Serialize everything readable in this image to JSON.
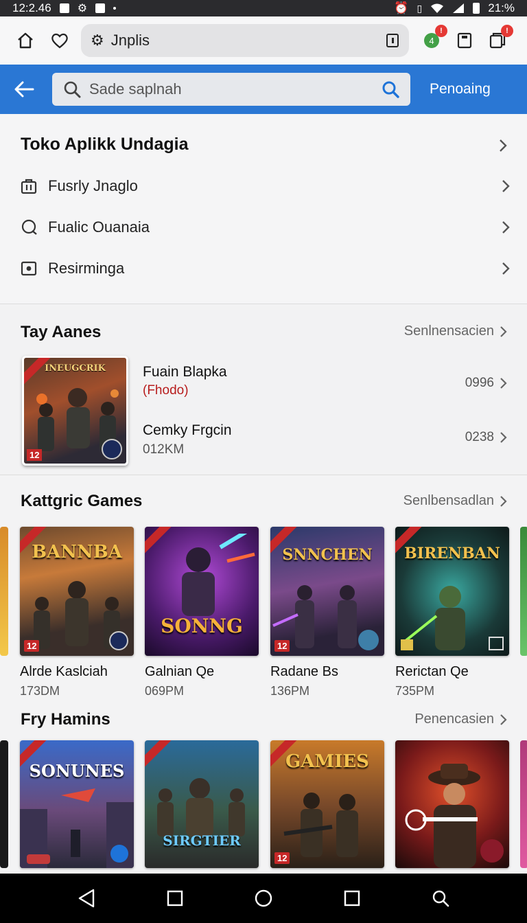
{
  "status_bar": {
    "time": "12:2.46",
    "battery": "21:%"
  },
  "browser": {
    "url_text": "Jnplis"
  },
  "header": {
    "search_placeholder": "Sade saplnah",
    "action_label": "Penoaing"
  },
  "menu": {
    "title": "Toko Aplikk Undagia",
    "items": [
      {
        "label": "Fusrly Jnaglo",
        "icon": "briefcase-icon"
      },
      {
        "label": "Fualic Ouanaia",
        "icon": "chat-icon"
      },
      {
        "label": "Resirminga",
        "icon": "camera-icon"
      }
    ]
  },
  "top_section": {
    "title": "Tay Aanes",
    "link": "Senlnensacien",
    "feature_art_label": "INEUGCRIK",
    "feature_tag": "12",
    "apps": [
      {
        "name": "Fuain Blapka",
        "sub": "(Fhodo)",
        "value": "0996"
      },
      {
        "name": "Cemky Frgcin",
        "sub": "012KM",
        "value": "0238"
      }
    ]
  },
  "kategori": {
    "title": "Kattgric Games",
    "link": "Senlbensadlan",
    "games": [
      {
        "title": "Alrde Kaslciah",
        "sub": "173DM",
        "art_text": "BANNBA",
        "tag": "12"
      },
      {
        "title": "Galnian Qe",
        "sub": "069PM",
        "art_text": "SONNG",
        "tag": ""
      },
      {
        "title": "Radane Bs",
        "sub": "136PM",
        "art_text": "SNNCHEN",
        "tag": "12"
      },
      {
        "title": "Rerictan Qe",
        "sub": "735PM",
        "art_text": "BIRENBAN",
        "tag": ""
      }
    ]
  },
  "fry": {
    "title": "Fry Hamins",
    "link": "Penencasien",
    "games": [
      {
        "art_text": "SONUNES",
        "tag": ""
      },
      {
        "art_text": "SIRGTIER",
        "tag": ""
      },
      {
        "art_text": "GAMIES",
        "tag": "12"
      },
      {
        "art_text": "",
        "tag": ""
      }
    ]
  }
}
